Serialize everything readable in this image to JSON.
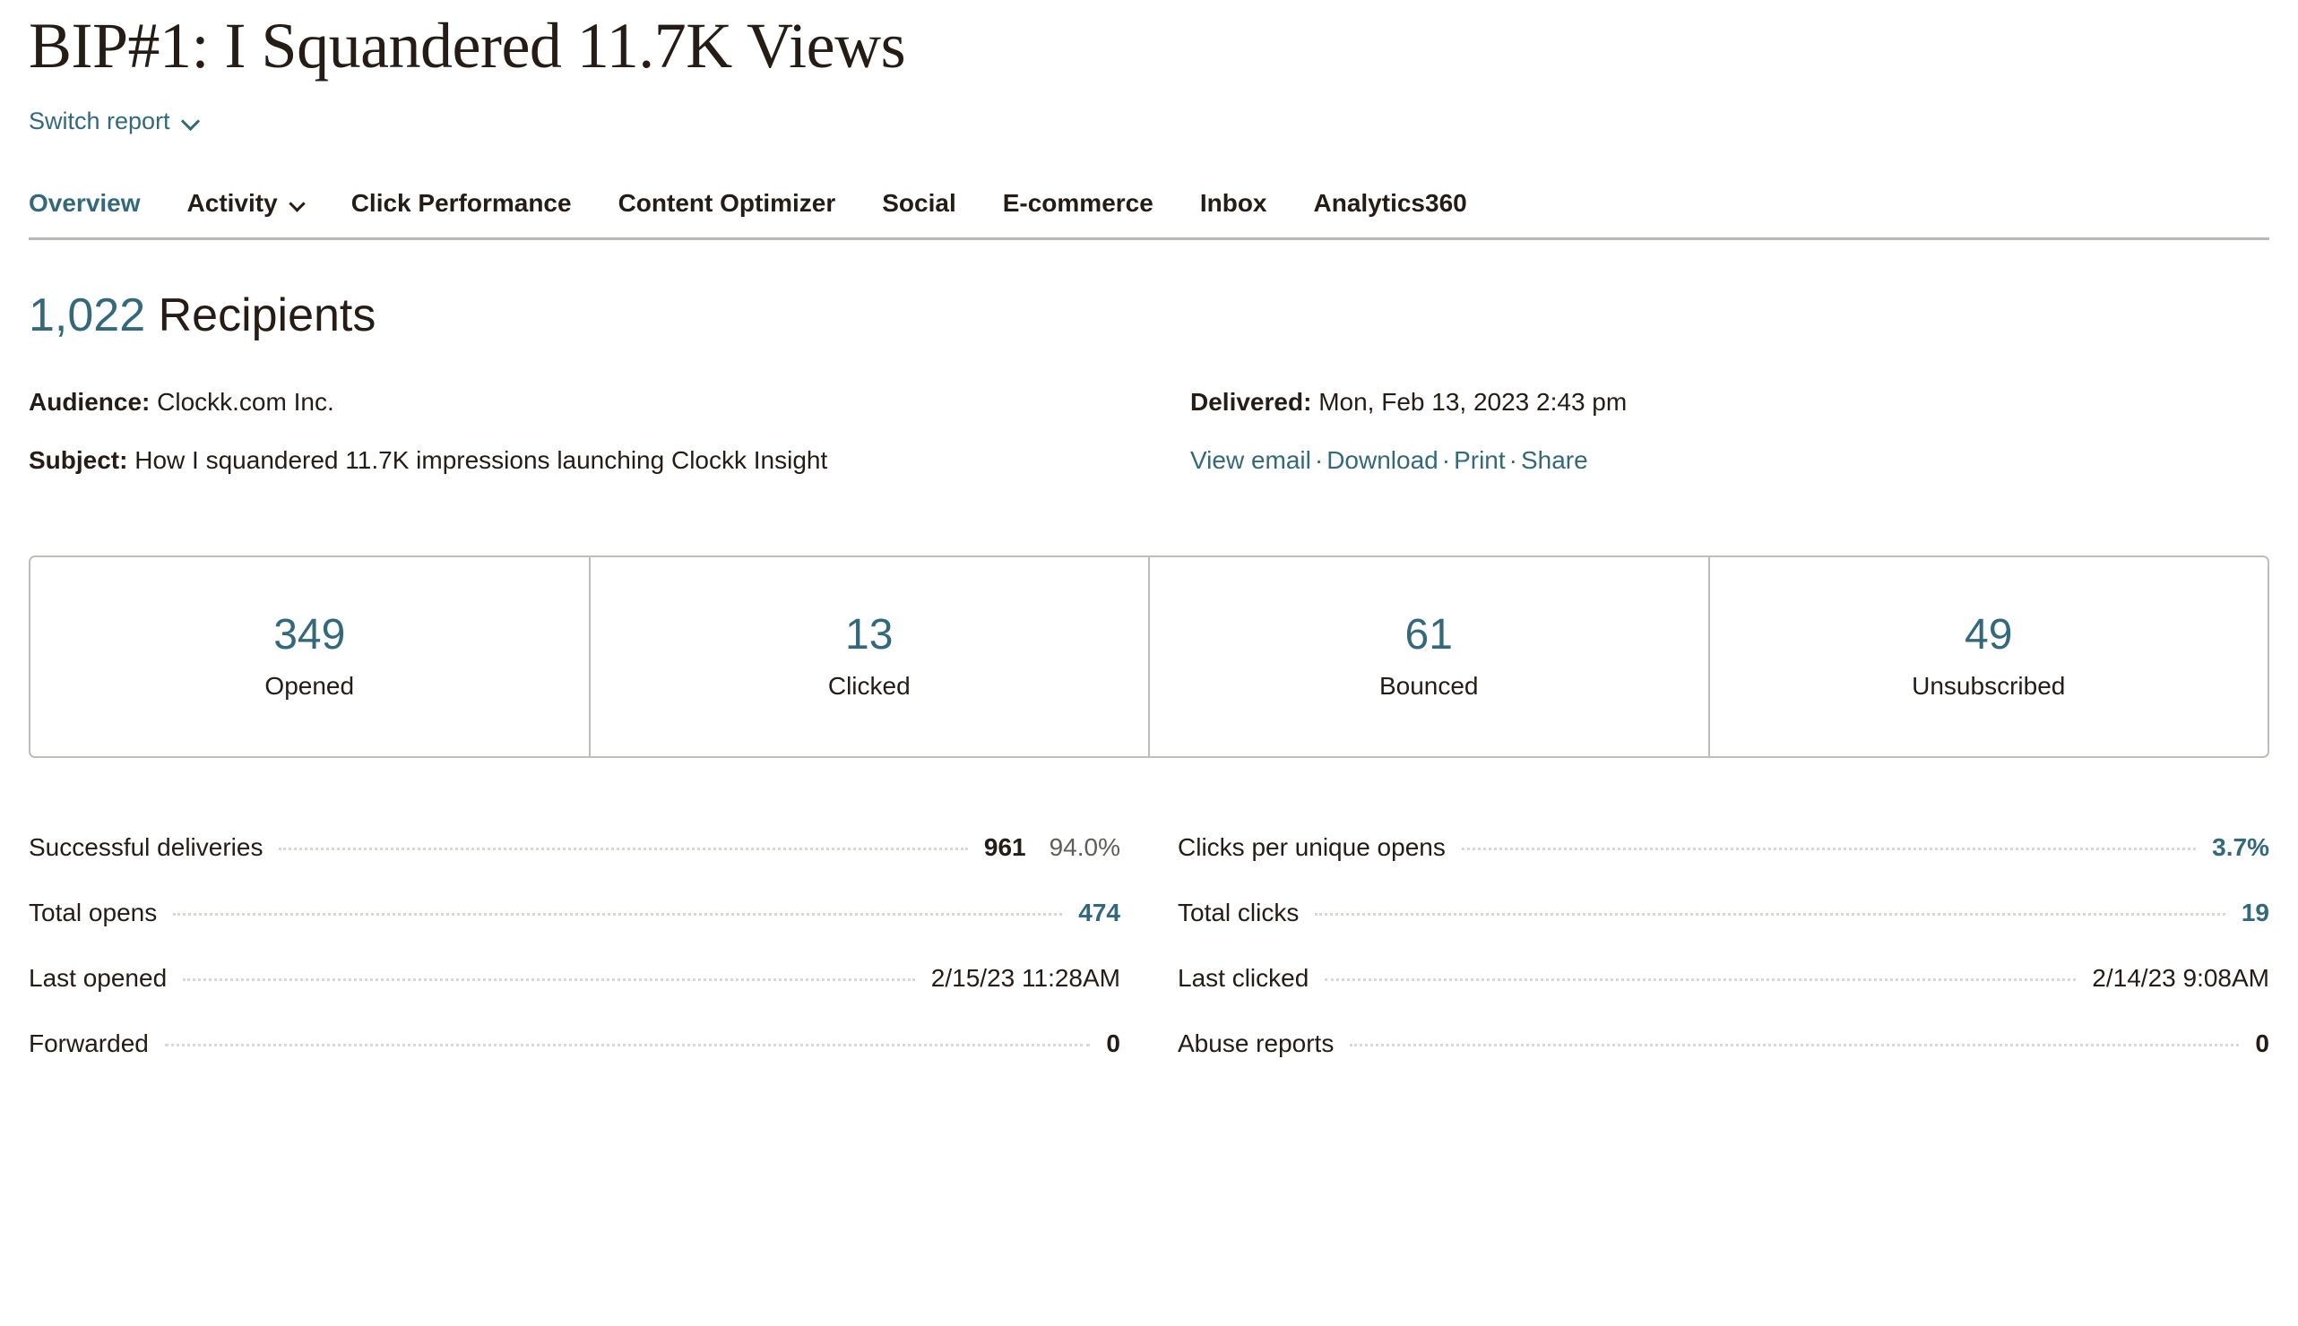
{
  "header": {
    "title": "BIP#1: I Squandered 11.7K Views",
    "switch_report_label": "Switch report"
  },
  "tabs": [
    {
      "label": "Overview",
      "active": true,
      "has_chevron": false
    },
    {
      "label": "Activity",
      "active": false,
      "has_chevron": true
    },
    {
      "label": "Click Performance",
      "active": false,
      "has_chevron": false
    },
    {
      "label": "Content Optimizer",
      "active": false,
      "has_chevron": false
    },
    {
      "label": "Social",
      "active": false,
      "has_chevron": false
    },
    {
      "label": "E-commerce",
      "active": false,
      "has_chevron": false
    },
    {
      "label": "Inbox",
      "active": false,
      "has_chevron": false
    },
    {
      "label": "Analytics360",
      "active": false,
      "has_chevron": false
    }
  ],
  "summary": {
    "recipients_count": "1,022",
    "recipients_label": "Recipients",
    "audience_key": "Audience:",
    "audience_value": "Clockk.com Inc.",
    "subject_key": "Subject:",
    "subject_value": "How I squandered 11.7K impressions launching Clockk Insight",
    "delivered_key": "Delivered:",
    "delivered_value": "Mon, Feb 13, 2023 2:43 pm",
    "links": [
      {
        "label": "View email"
      },
      {
        "label": "Download"
      },
      {
        "label": "Print"
      },
      {
        "label": "Share"
      }
    ],
    "link_separator": "·"
  },
  "stat_cards": [
    {
      "value": "349",
      "label": "Opened"
    },
    {
      "value": "13",
      "label": "Clicked"
    },
    {
      "value": "61",
      "label": "Bounced"
    },
    {
      "value": "49",
      "label": "Unsubscribed"
    }
  ],
  "stats_left": [
    {
      "name": "Successful deliveries",
      "value": "961",
      "percent": "94.0%",
      "teal": false
    },
    {
      "name": "Total opens",
      "value": "474",
      "percent": "",
      "teal": true
    },
    {
      "name": "Last opened",
      "value": "2/15/23 11:28AM",
      "percent": "",
      "teal": false,
      "plain": true
    },
    {
      "name": "Forwarded",
      "value": "0",
      "percent": "",
      "teal": false
    }
  ],
  "stats_right": [
    {
      "name": "Clicks per unique opens",
      "value": "3.7%",
      "percent": "",
      "teal": true
    },
    {
      "name": "Total clicks",
      "value": "19",
      "percent": "",
      "teal": true
    },
    {
      "name": "Last clicked",
      "value": "2/14/23 9:08AM",
      "percent": "",
      "teal": false,
      "plain": true
    },
    {
      "name": "Abuse reports",
      "value": "0",
      "percent": "",
      "teal": false
    }
  ],
  "colors": {
    "accent_teal": "#33697a",
    "text_dark": "#241c15",
    "border_gray": "#bdbdb9",
    "leader_dotted": "#d8d8d4",
    "percent_gray": "#5e5e5a"
  }
}
